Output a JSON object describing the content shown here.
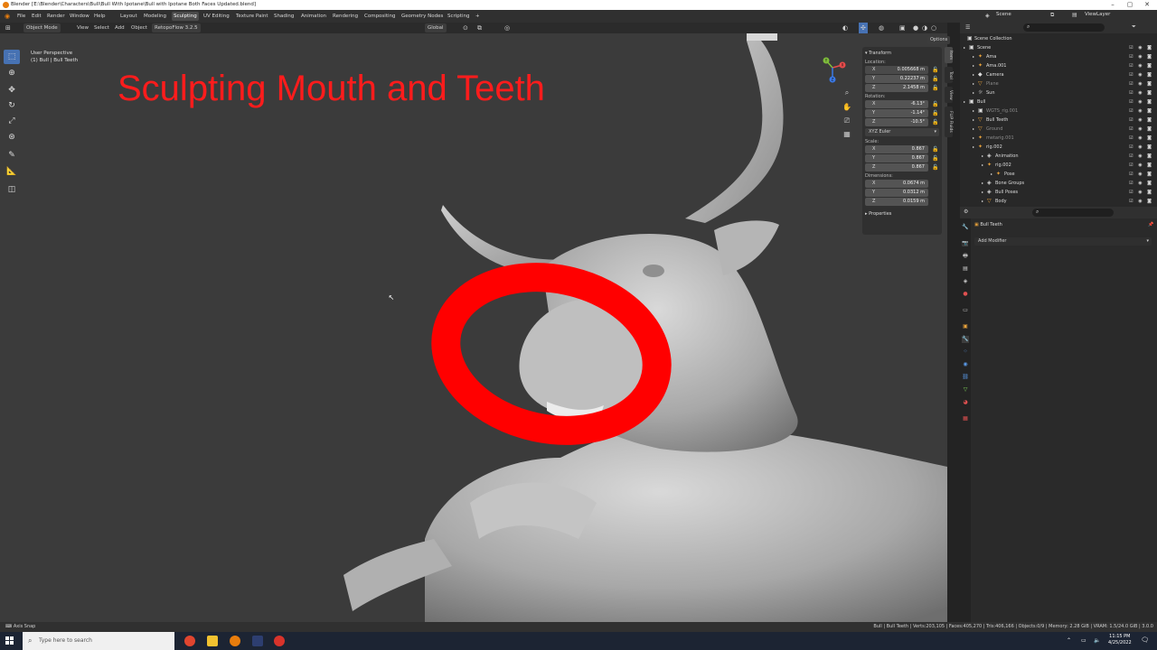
{
  "window": {
    "title": "Blender [E:\\Blender\\Characters\\Bull\\Bull With Ipotane\\Bull with Ipotane Both Faces Updated.blend]",
    "controls": [
      "–",
      "▢",
      "✕"
    ]
  },
  "menu": {
    "items": [
      "File",
      "Edit",
      "Render",
      "Window",
      "Help"
    ],
    "workspaces": [
      "Layout",
      "Modeling",
      "Sculpting",
      "UV Editing",
      "Texture Paint",
      "Shading",
      "Animation",
      "Rendering",
      "Compositing",
      "Geometry Nodes",
      "Scripting",
      "+"
    ],
    "active_workspace": "Sculpting"
  },
  "header3d": {
    "mode": "Object Mode",
    "items": [
      "View",
      "Select",
      "Add",
      "Object"
    ],
    "addon": "RetopoFlow 3.2.5",
    "orientation": "Global",
    "options": "Options"
  },
  "viewport": {
    "perspective": "User Perspective",
    "object_info": "(1) Bull | Bull Teeth",
    "annotation": "Sculpting Mouth and Teeth",
    "annotation_color": "#ff1c1c",
    "gizmo_labels": [
      "X",
      "Y",
      "Z"
    ]
  },
  "npanel": {
    "title": "Transform",
    "location_label": "Location:",
    "location": [
      {
        "axis": "X",
        "value": "0.005668 m"
      },
      {
        "axis": "Y",
        "value": "0.22237 m"
      },
      {
        "axis": "Z",
        "value": "2.1458 m"
      }
    ],
    "rotation_label": "Rotation:",
    "rotation": [
      {
        "axis": "X",
        "value": "-6.13°"
      },
      {
        "axis": "Y",
        "value": "-1.14°"
      },
      {
        "axis": "Z",
        "value": "-10.5°"
      }
    ],
    "rotation_mode": "XYZ Euler",
    "scale_label": "Scale:",
    "scale": [
      {
        "axis": "X",
        "value": "0.867"
      },
      {
        "axis": "Y",
        "value": "0.867"
      },
      {
        "axis": "Z",
        "value": "0.867"
      }
    ],
    "dimensions_label": "Dimensions:",
    "dimensions": [
      {
        "axis": "X",
        "value": "0.0674 m"
      },
      {
        "axis": "Y",
        "value": "0.0312 m"
      },
      {
        "axis": "Z",
        "value": "0.0159 m"
      }
    ],
    "properties": "Properties",
    "tabs": [
      "Item",
      "Tool",
      "View",
      "FLIP Fluids"
    ]
  },
  "outliner": {
    "scene": "Scene",
    "view_layer": "ViewLayer",
    "collection": "Scene Collection",
    "rows": [
      {
        "name": "Scene",
        "indent": 1,
        "icon": "▣",
        "color": "#dcdcdc"
      },
      {
        "name": "Ama",
        "indent": 2,
        "icon": "✦",
        "color": "#dcdcdc"
      },
      {
        "name": "Ama.001",
        "indent": 2,
        "icon": "✦",
        "color": "#dcdcdc"
      },
      {
        "name": "Camera",
        "indent": 2,
        "icon": "◆",
        "color": "#dcdcdc"
      },
      {
        "name": "Plane",
        "indent": 2,
        "icon": "▽",
        "color": "#8a8a8a"
      },
      {
        "name": "Sun",
        "indent": 2,
        "icon": "☼",
        "color": "#dcdcdc"
      },
      {
        "name": "Bull",
        "indent": 1,
        "icon": "▣",
        "color": "#dcdcdc"
      },
      {
        "name": "WGTS_rig.001",
        "indent": 2,
        "icon": "▣",
        "color": "#8a8a8a"
      },
      {
        "name": "Bull Teeth",
        "indent": 2,
        "icon": "▽",
        "color": "#dcdcdc"
      },
      {
        "name": "Ground",
        "indent": 2,
        "icon": "▽",
        "color": "#8a8a8a"
      },
      {
        "name": "metarig.001",
        "indent": 2,
        "icon": "✦",
        "color": "#8a8a8a"
      },
      {
        "name": "rig.002",
        "indent": 2,
        "icon": "✦",
        "color": "#dcdcdc"
      },
      {
        "name": "Animation",
        "indent": 3,
        "icon": "◈",
        "color": "#dcdcdc"
      },
      {
        "name": "rig.002",
        "indent": 3,
        "icon": "✦",
        "color": "#dcdcdc"
      },
      {
        "name": "Pose",
        "indent": 4,
        "icon": "✦",
        "color": "#dcdcdc"
      },
      {
        "name": "Bone Groups",
        "indent": 3,
        "icon": "◈",
        "color": "#dcdcdc"
      },
      {
        "name": "Bull Poses",
        "indent": 3,
        "icon": "◈",
        "color": "#dcdcdc"
      },
      {
        "name": "Body",
        "indent": 3,
        "icon": "▽",
        "color": "#dcdcdc"
      }
    ]
  },
  "properties": {
    "object_name": "Bull Teeth",
    "add_modifier": "Add Modifier"
  },
  "status": {
    "left": "Axis Snap",
    "right": "Bull | Bull Teeth | Verts:203,105 | Faces:405,270 | Tris:406,166 | Objects:0/9 | Memory: 2.28 GiB | VRAM: 1.5/24.0 GiB | 3.0.0"
  },
  "taskbar": {
    "search_placeholder": "Type here to search",
    "time": "11:15 PM",
    "date": "4/25/2022"
  },
  "colors": {
    "accent": "#4772b3",
    "annotation": "#ff1c1c"
  }
}
